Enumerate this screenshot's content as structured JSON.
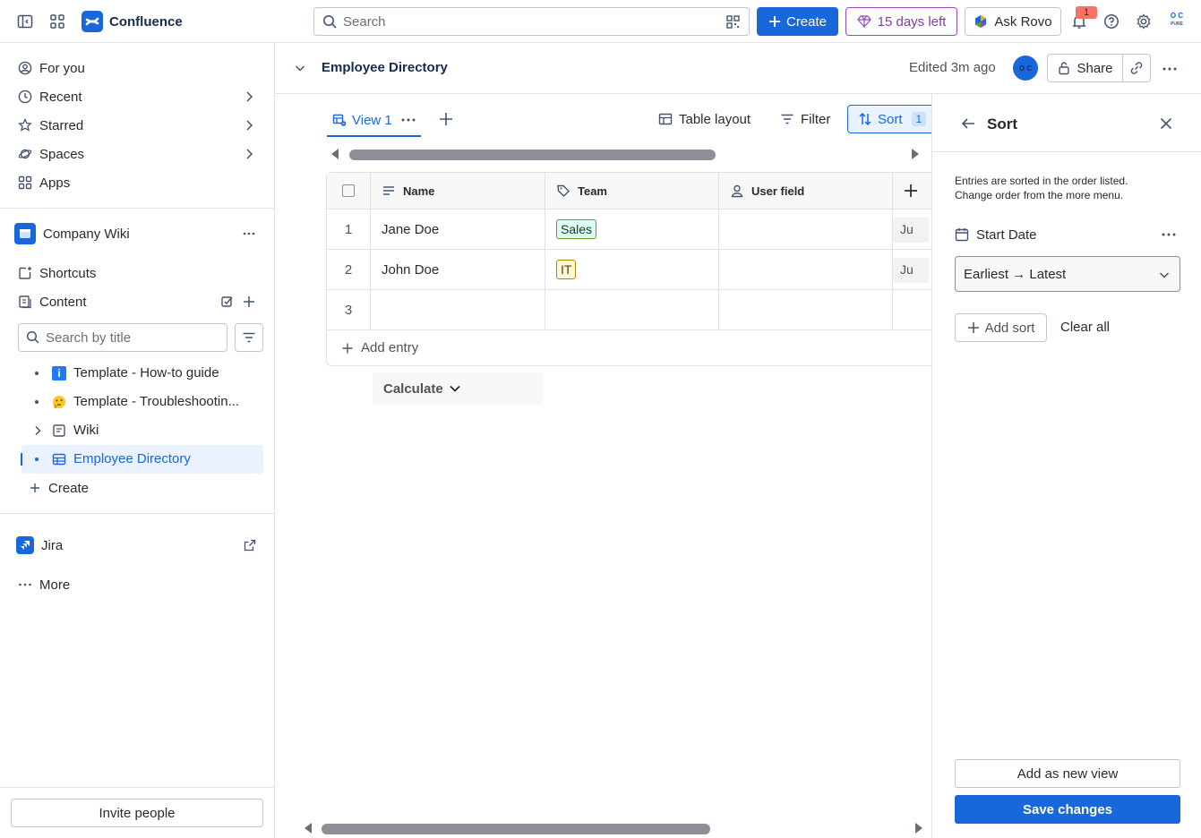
{
  "topbar": {
    "app_name": "Confluence",
    "search_placeholder": "Search",
    "create_label": "Create",
    "trial_label": "15 days left",
    "rovo_label": "Ask Rovo",
    "notification_count": "1",
    "profile_initials_top": "O C",
    "profile_initials_bottom": "PURE"
  },
  "sidebar": {
    "nav": [
      {
        "label": "For you",
        "icon": "person-circle-icon"
      },
      {
        "label": "Recent",
        "icon": "clock-icon"
      },
      {
        "label": "Starred",
        "icon": "star-icon"
      },
      {
        "label": "Spaces",
        "icon": "planet-icon"
      },
      {
        "label": "Apps",
        "icon": "apps-icon"
      }
    ],
    "space_name": "Company Wiki",
    "shortcuts_label": "Shortcuts",
    "content_label": "Content",
    "title_search_placeholder": "Search by title",
    "tree": [
      {
        "label": "Template - How-to guide",
        "icon": "info-icon"
      },
      {
        "label": "Template - Troubleshootin...",
        "icon": "emoji-thinking-icon"
      },
      {
        "label": "Wiki",
        "icon": "page-icon"
      },
      {
        "label": "Employee Directory",
        "icon": "database-icon"
      }
    ],
    "create_label": "Create",
    "jira_label": "Jira",
    "more_label": "More",
    "invite_label": "Invite people"
  },
  "page": {
    "title": "Employee Directory",
    "edited": "Edited 3m ago",
    "owner_initials": "O C",
    "share_label": "Share"
  },
  "database": {
    "view_tab": "View 1",
    "table_layout_label": "Table layout",
    "filter_label": "Filter",
    "sort_label": "Sort",
    "sort_count": "1",
    "columns": [
      {
        "label": "Name",
        "icon": "text-lines-icon"
      },
      {
        "label": "Team",
        "icon": "tag-icon"
      },
      {
        "label": "User field",
        "icon": "person-icon"
      }
    ],
    "rows": [
      {
        "num": "1",
        "name": "Jane Doe",
        "team": "Sales",
        "date_cut": "Ju"
      },
      {
        "num": "2",
        "name": "John Doe",
        "team": "IT",
        "date_cut": "Ju"
      },
      {
        "num": "3",
        "name": "",
        "team": "",
        "date_cut": ""
      }
    ],
    "add_entry_label": "Add entry",
    "calculate_label": "Calculate",
    "scroll_top_fraction": 0.79,
    "scroll_bottom_fraction": 0.7
  },
  "sort_panel": {
    "title": "Sort",
    "description_line1": "Entries are sorted in the order listed.",
    "description_line2": "Change order from the more menu.",
    "field_name": "Start Date",
    "order_value": "Earliest → Latest",
    "add_sort_label": "Add sort",
    "clear_all_label": "Clear all",
    "add_view_label": "Add as new view",
    "save_label": "Save changes"
  },
  "colors": {
    "brand": "#1868db",
    "trial": "#803fa5",
    "badge": "#f87168",
    "tag_sales": "#dcfff1",
    "tag_it": "#fff7d6"
  }
}
